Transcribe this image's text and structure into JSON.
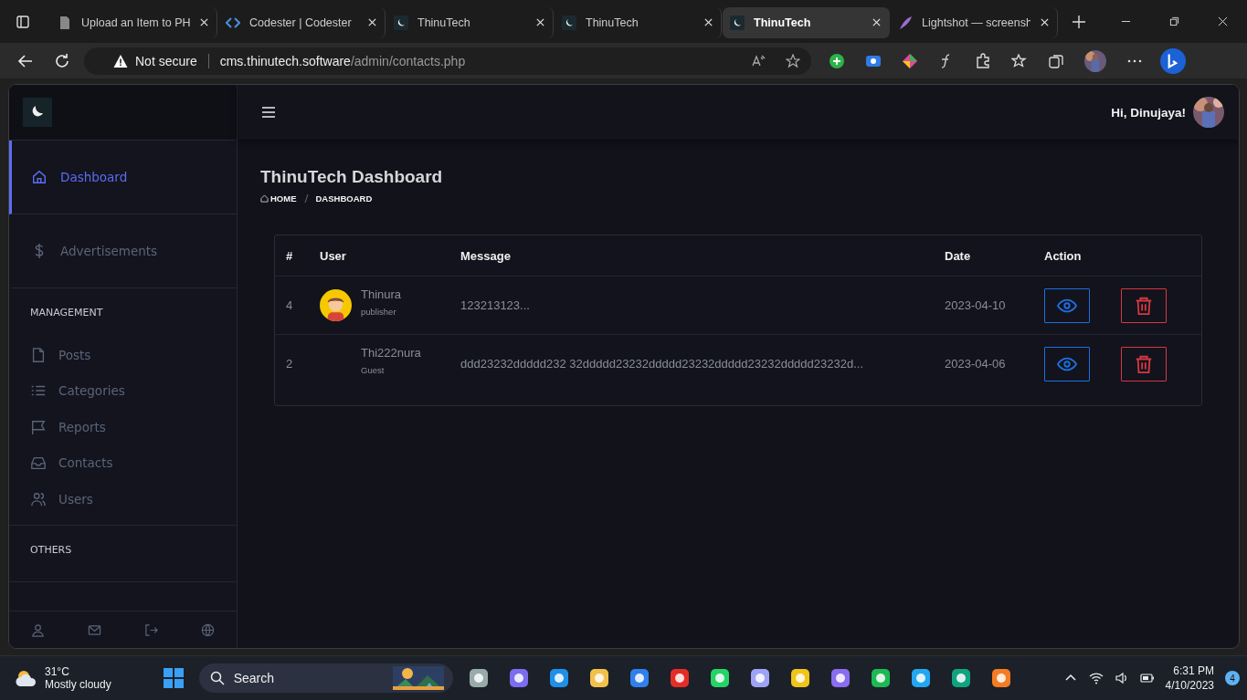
{
  "browser": {
    "tabs": [
      {
        "title": "Upload an Item to PH",
        "kind": "doc",
        "selected": false
      },
      {
        "title": "Codester | Codester",
        "kind": "code",
        "selected": false
      },
      {
        "title": "ThinuTech",
        "kind": "moon",
        "selected": false
      },
      {
        "title": "ThinuTech",
        "kind": "moon",
        "selected": false
      },
      {
        "title": "ThinuTech",
        "kind": "moon",
        "selected": true
      },
      {
        "title": "Lightshot — screensh",
        "kind": "feather",
        "selected": false
      }
    ],
    "security": "Not secure",
    "url_host": "cms.thinutech.software",
    "url_path": "/admin/contacts.php"
  },
  "sidebar": {
    "nav": [
      {
        "label": "Dashboard",
        "kind": "home",
        "selected": true
      },
      {
        "label": "Advertisements",
        "kind": "dollar",
        "selected": false
      }
    ],
    "sections": [
      {
        "title": "MANAGEMENT",
        "items": [
          {
            "label": "Posts",
            "kind": "file",
            "selected": false
          },
          {
            "label": "Categories",
            "kind": "list",
            "selected": false
          },
          {
            "label": "Reports",
            "kind": "flag",
            "selected": false
          },
          {
            "label": "Contacts",
            "kind": "inbox",
            "selected": false
          },
          {
            "label": "Users",
            "kind": "users",
            "selected": false
          }
        ]
      },
      {
        "title": "OTHERS"
      }
    ]
  },
  "header": {
    "greeting": "Hi, Dinujaya!"
  },
  "page": {
    "title": "ThinuTech Dashboard",
    "breadcrumb": [
      "HOME",
      "DASHBOARD"
    ]
  },
  "table": {
    "columns": [
      "#",
      "User",
      "Message",
      "Date",
      "Action"
    ],
    "rows": [
      {
        "id": "4",
        "name": "Thinura",
        "role": "publisher",
        "avatar": true,
        "message": "123213123...",
        "date": "2023-04-10"
      },
      {
        "id": "2",
        "name": "Thi222nura",
        "role": "Guest",
        "avatar": false,
        "message": "ddd23232ddddd232 32ddddd23232ddddd23232ddddd23232ddddd23232d...",
        "date": "2023-04-06"
      }
    ]
  },
  "taskbar": {
    "temperature": "31°C",
    "weather": "Mostly cloudy",
    "search_label": "Search",
    "time": "6:31 PM",
    "date": "4/10/2023",
    "notifications": "4"
  }
}
